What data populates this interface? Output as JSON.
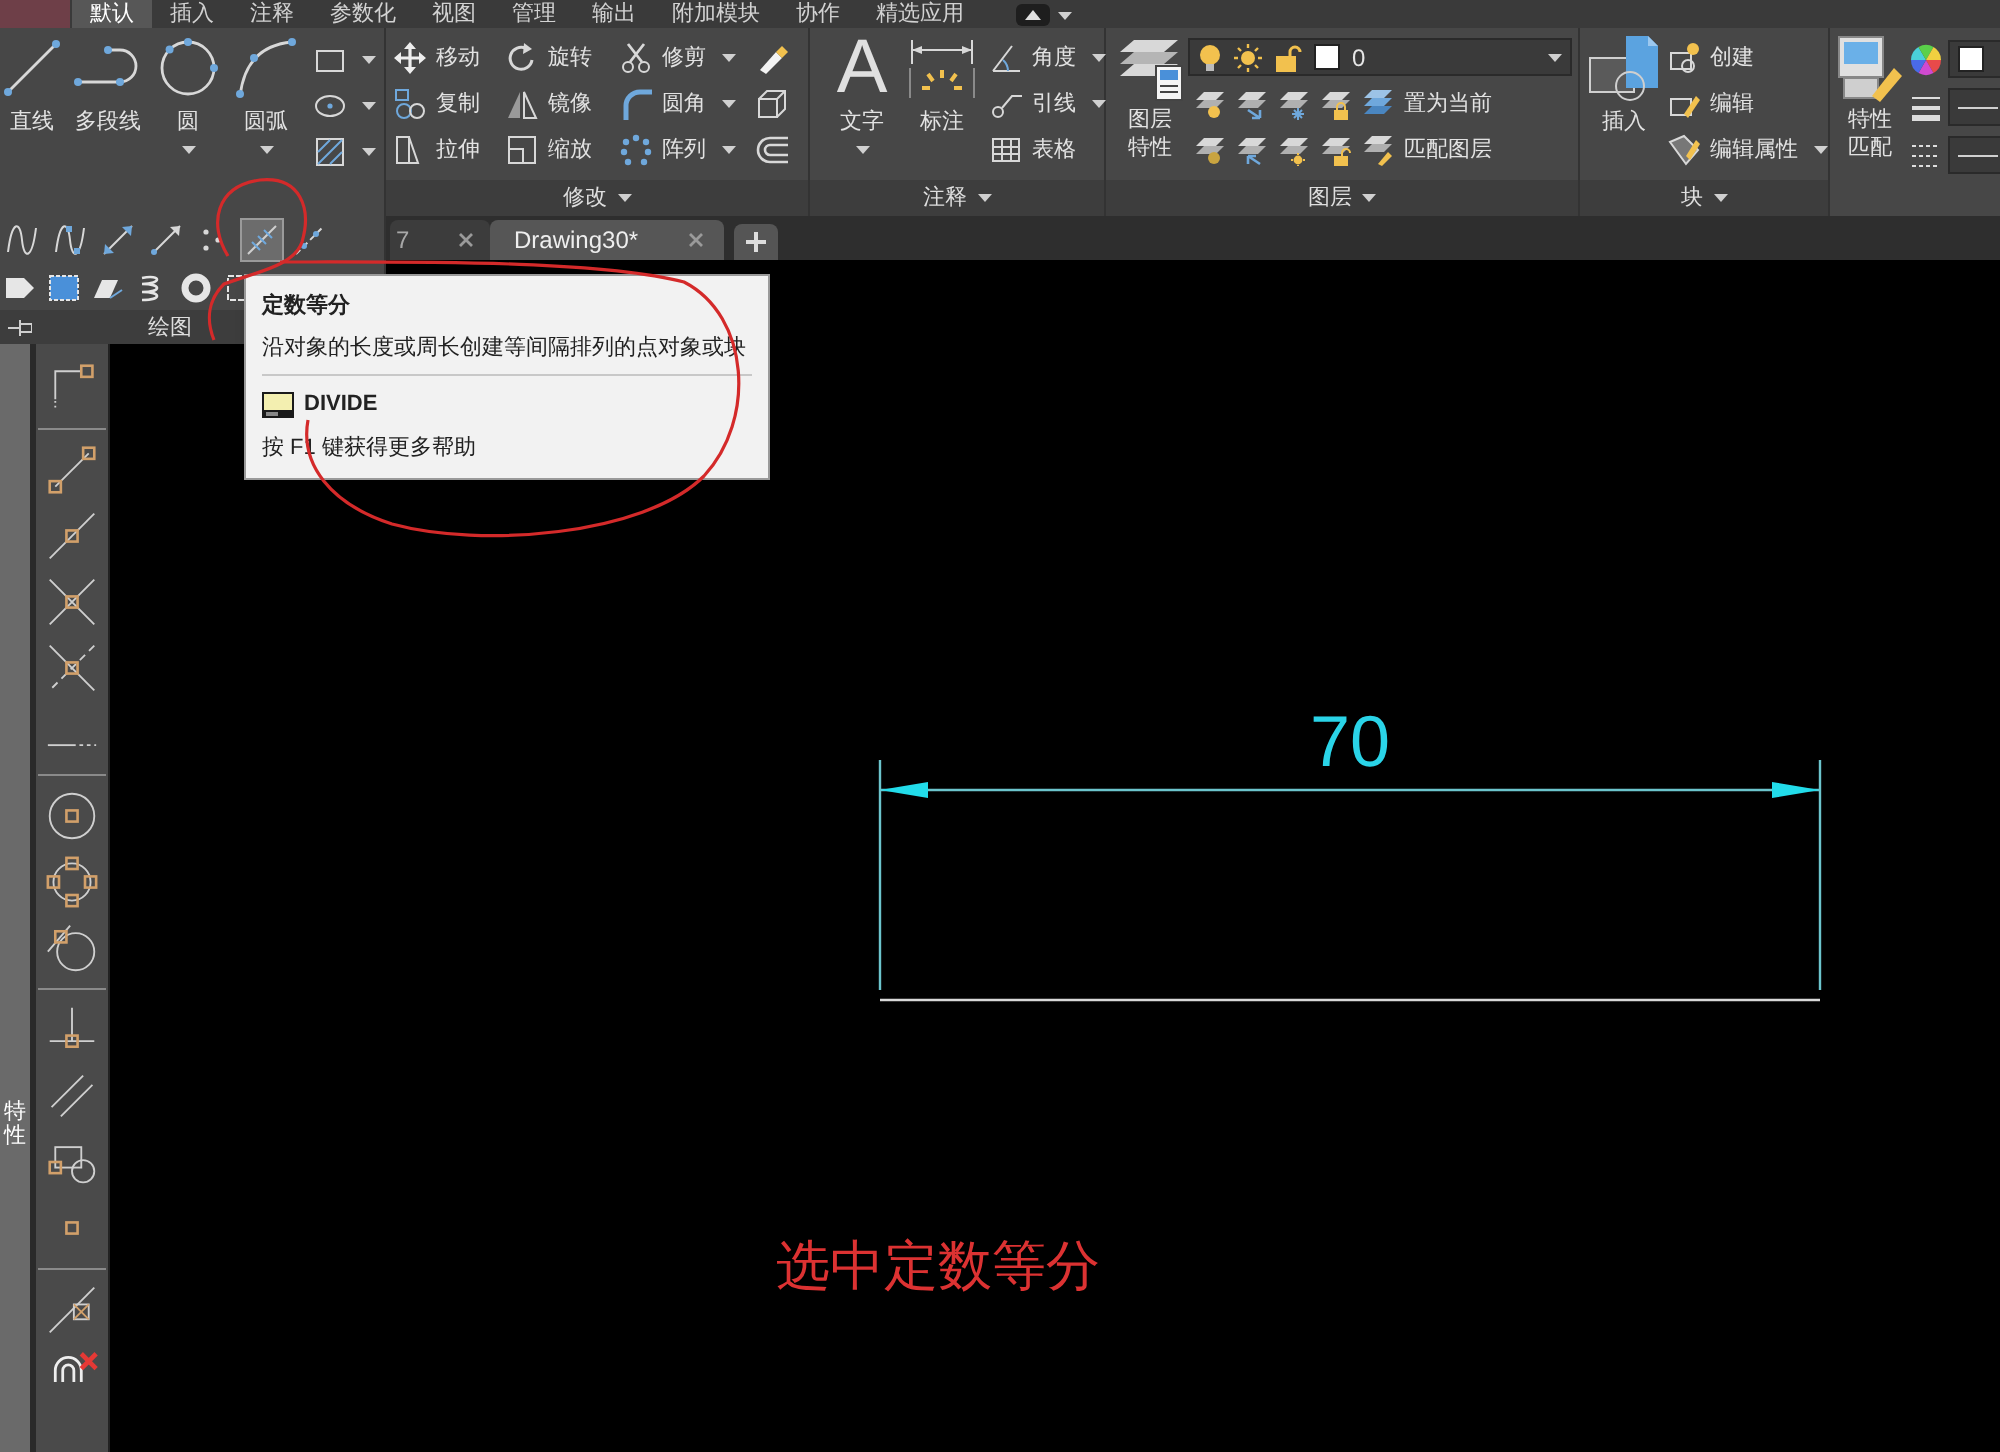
{
  "menu_tabs": [
    {
      "label": "默认",
      "selected": true
    },
    {
      "label": "插入",
      "selected": false
    },
    {
      "label": "注释",
      "selected": false
    },
    {
      "label": "参数化",
      "selected": false
    },
    {
      "label": "视图",
      "selected": false
    },
    {
      "label": "管理",
      "selected": false
    },
    {
      "label": "输出",
      "selected": false
    },
    {
      "label": "附加模块",
      "selected": false
    },
    {
      "label": "协作",
      "selected": false
    },
    {
      "label": "精选应用",
      "selected": false
    }
  ],
  "ribbon": {
    "draw": {
      "title": "绘图",
      "large_tools": [
        {
          "label": "直线",
          "dropdown": false
        },
        {
          "label": "多段线",
          "dropdown": false
        },
        {
          "label": "圆",
          "dropdown": true
        },
        {
          "label": "圆弧",
          "dropdown": true
        }
      ],
      "small_tools": [
        {
          "dropdown": true
        },
        {
          "dropdown": true
        },
        {
          "dropdown": true
        }
      ],
      "expanded_rows": [
        [
          {
            "selected": false
          },
          {
            "selected": false
          },
          {
            "selected": false
          },
          {
            "selected": false
          },
          {
            "selected": false
          },
          {
            "selected": true
          },
          {
            "selected": false
          }
        ],
        [
          {
            "selected": false
          },
          {
            "selected": false
          },
          {
            "selected": false
          },
          {
            "selected": false
          },
          {
            "selected": false
          },
          {
            "selected": false
          }
        ]
      ]
    },
    "modify": {
      "title": "修改",
      "tools": [
        {
          "label": "移动",
          "dropdown": false
        },
        {
          "label": "旋转",
          "dropdown": false
        },
        {
          "label": "修剪",
          "dropdown": true
        },
        {
          "label": "复制",
          "dropdown": false
        },
        {
          "label": "镜像",
          "dropdown": false
        },
        {
          "label": "圆角",
          "dropdown": true
        },
        {
          "label": "拉伸",
          "dropdown": false
        },
        {
          "label": "缩放",
          "dropdown": false
        },
        {
          "label": "阵列",
          "dropdown": true
        }
      ]
    },
    "annotation": {
      "title": "注释",
      "large_tools": [
        {
          "label": "文字",
          "glyph": "A",
          "dropdown": true
        },
        {
          "label": "标注",
          "dropdown": false
        }
      ],
      "tools": [
        {
          "label": "角度",
          "dropdown": true
        },
        {
          "label": "引线",
          "dropdown": true
        },
        {
          "label": "表格",
          "dropdown": false
        }
      ]
    },
    "layers": {
      "title": "图层",
      "properties_label": "图层特性",
      "current_layer": "0",
      "tools": [
        {
          "label": "置为当前"
        },
        {
          "label": "匹配图层"
        }
      ]
    },
    "block": {
      "title": "块",
      "insert_label": "插入",
      "tools": [
        {
          "label": "创建",
          "dropdown": false
        },
        {
          "label": "编辑",
          "dropdown": false
        },
        {
          "label": "编辑属性",
          "dropdown": true
        }
      ]
    },
    "properties": {
      "match_label": "特性匹配"
    }
  },
  "file_tabs": [
    {
      "label": "7",
      "selected": false
    },
    {
      "label": "Drawing30*",
      "selected": true
    }
  ],
  "tooltip": {
    "title": "定数等分",
    "description": "沿对象的长度或周长创建等间隔排列的点对象或块",
    "command": "DIVIDE",
    "help": "按 F1 键获得更多帮助"
  },
  "properties_palette": {
    "label": "特性"
  },
  "drawing": {
    "dimension_text": "70"
  },
  "caption": "选中定数等分"
}
